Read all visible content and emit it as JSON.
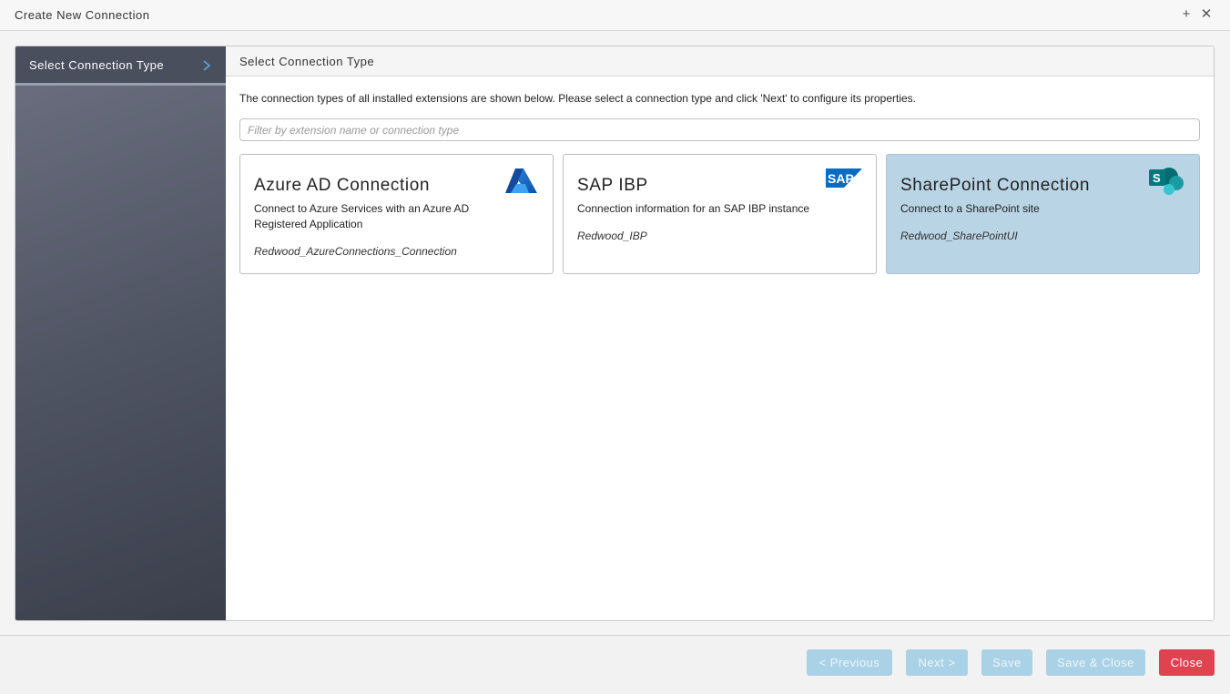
{
  "window": {
    "title": "Create New Connection",
    "maximize_glyph": "+",
    "close_glyph": "✕"
  },
  "sidebar": {
    "items": [
      {
        "label": "Select Connection Type",
        "icon": "chevron-right-icon",
        "active": true
      }
    ]
  },
  "main": {
    "header": "Select Connection Type",
    "description": "The connection types of all installed extensions are shown below. Please select a connection type and click 'Next' to configure its properties.",
    "filter": {
      "placeholder": "Filter by extension name or connection type",
      "value": ""
    },
    "cards": [
      {
        "title": "Azure AD Connection",
        "description": "Connect to Azure Services with an Azure AD Registered Application",
        "extension": "Redwood_AzureConnections_Connection",
        "icon": "azure-logo-icon",
        "selected": false
      },
      {
        "title": "SAP IBP",
        "description": "Connection information for an SAP IBP instance",
        "extension": "Redwood_IBP",
        "icon": "sap-logo-icon",
        "logo_text": "SAP",
        "selected": false
      },
      {
        "title": "SharePoint Connection",
        "description": "Connect to a SharePoint site",
        "extension": "Redwood_SharePointUI",
        "icon": "sharepoint-logo-icon",
        "logo_text": "S",
        "selected": true
      }
    ]
  },
  "footer": {
    "previous": "< Previous",
    "next": "Next >",
    "save": "Save",
    "save_close": "Save & Close",
    "close": "Close"
  },
  "colors": {
    "selected_card": "#b9d4e4",
    "disabled_button": "#a9d2e6",
    "close_button": "#e0424f",
    "sidebar": "#4e5362"
  }
}
